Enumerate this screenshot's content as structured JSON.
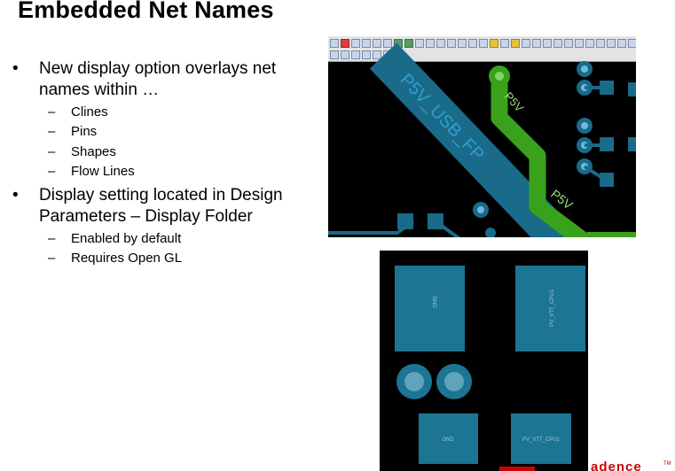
{
  "title": "Embedded Net Names",
  "bullets": [
    {
      "marker": "•",
      "text": [
        "New display option overlays net",
        "names within …"
      ],
      "subitems": [
        "Clines",
        "Pins",
        "Shapes",
        "Flow Lines"
      ]
    },
    {
      "marker": "•",
      "text": [
        "Display setting located in Design",
        "Parameters – Display Folder"
      ],
      "subitems": [
        "Enabled by default",
        "Requires Open GL"
      ]
    }
  ],
  "sub_marker": "–",
  "pcb_top": {
    "net_labels": [
      "P5V_USB_FP",
      "P5V",
      "P5V"
    ],
    "colors": {
      "trace_blue": "#1a6a8a",
      "trace_green": "#3aa11c",
      "label_blue": "#2f9fcb",
      "label_green": "#9be07a",
      "toolbar_bg": "#e3e3e3"
    }
  },
  "pcb_bottom": {
    "pad_labels": [
      "GND",
      "PV_VTT_CPU1",
      "GND",
      "PV_VTT_CPU1"
    ],
    "colors": {
      "pad": "#1b7593",
      "label": "#9ec9d8",
      "via_ring": "#1b7593",
      "via_hole": "#5fa4bc"
    }
  },
  "logo": {
    "text": "adence",
    "mark": "TM",
    "color": "#cc0000"
  }
}
